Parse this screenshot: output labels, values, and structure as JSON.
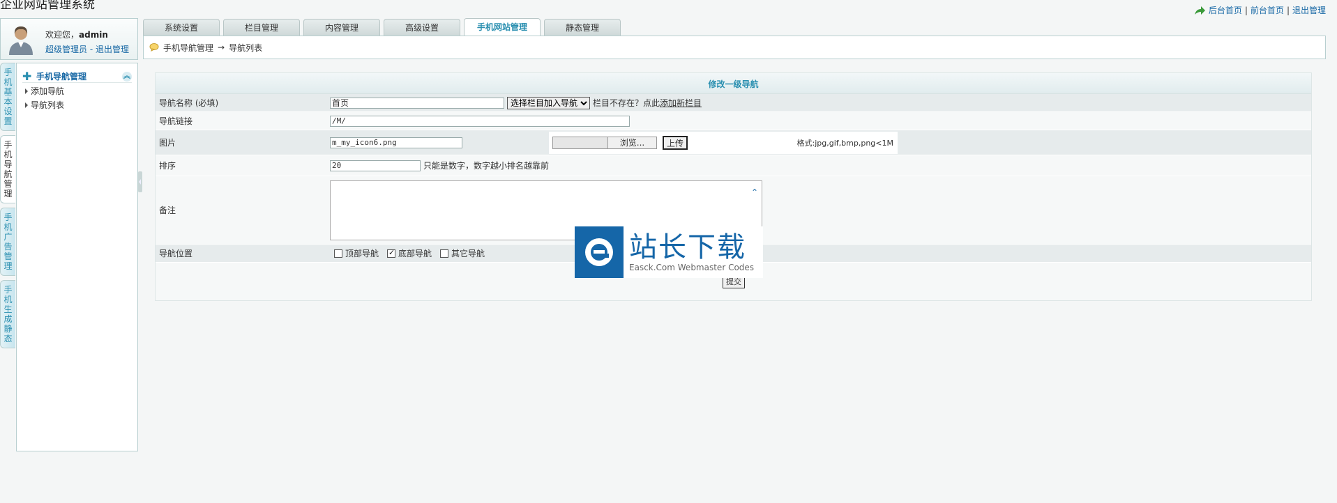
{
  "app": {
    "title": "企业网站管理系统"
  },
  "top_links": {
    "backend_home": "后台首页",
    "frontend_home": "前台首页",
    "logout": "退出管理",
    "separator": "|"
  },
  "user": {
    "welcome": "欢迎您，",
    "name": "admin",
    "role": "超级管理员",
    "dash": " - ",
    "logout": "退出管理"
  },
  "tabs": [
    {
      "label": "系统设置",
      "active": false
    },
    {
      "label": "栏目管理",
      "active": false
    },
    {
      "label": "内容管理",
      "active": false
    },
    {
      "label": "高级设置",
      "active": false
    },
    {
      "label": "手机网站管理",
      "active": true
    },
    {
      "label": "静态管理",
      "active": false
    }
  ],
  "breadcrumb": {
    "parent": "手机导航管理",
    "arrow": "→",
    "current": "导航列表"
  },
  "side_tabs": [
    {
      "label": "手机基本设置",
      "active": false
    },
    {
      "label": "手机导航管理",
      "active": true
    },
    {
      "label": "手机广告管理",
      "active": false
    },
    {
      "label": "手机生成静态",
      "active": false
    }
  ],
  "left_menu": {
    "header": "手机导航管理",
    "items": [
      {
        "label": "添加导航"
      },
      {
        "label": "导航列表"
      }
    ]
  },
  "form": {
    "title": "修改一级导航",
    "name_label": "导航名称 (必填)",
    "name_value": "首页",
    "select_value": "选择栏目加入导航",
    "name_hint": "栏目不存在？点此",
    "name_hint_link": "添加新栏目",
    "link_label": "导航链接",
    "link_value": "/M/",
    "image_label": "图片",
    "image_value": "m_my_icon6.png",
    "browse_label": "浏览...",
    "upload_label": "上传",
    "format_hint": "格式:jpg,gif,bmp,png<1M",
    "order_label": "排序",
    "order_value": "20",
    "order_hint": "只能是数字，数字越小排名越靠前",
    "note_label": "备注",
    "position_label": "导航位置",
    "positions": [
      {
        "label": "顶部导航",
        "checked": false
      },
      {
        "label": "底部导航",
        "checked": true
      },
      {
        "label": "其它导航",
        "checked": false
      }
    ],
    "submit_label": "提交"
  },
  "watermark": {
    "cn": "站长下载",
    "en": "Easck.Com Webmaster Codes"
  },
  "colors": {
    "accent": "#2a8fb0",
    "link": "#1a6aa6",
    "watermark_blue": "#1566a8"
  }
}
